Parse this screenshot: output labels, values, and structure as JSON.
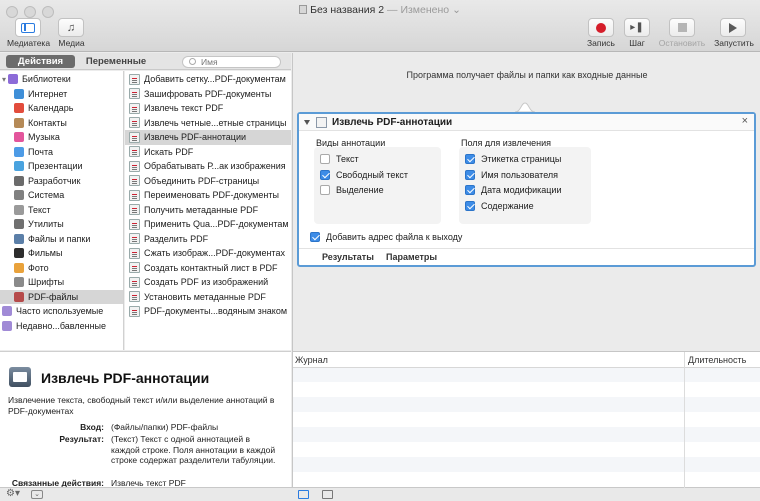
{
  "window": {
    "title": "Без названия 2",
    "status": "— Изменено"
  },
  "toolbar": {
    "library_label": "Медиатека",
    "media_label": "Медиа",
    "record_label": "Запись",
    "step_label": "Шаг",
    "stop_label": "Остановить",
    "run_label": "Запустить"
  },
  "tabs": {
    "actions": "Действия",
    "variables": "Переменные"
  },
  "search": {
    "placeholder": "Имя"
  },
  "library": {
    "items": [
      {
        "label": "Библиотеки",
        "icon": "library-icon",
        "color": "#8c6bd8"
      },
      {
        "label": "Интернет",
        "icon": "globe-icon",
        "color": "#3f8fd8"
      },
      {
        "label": "Календарь",
        "icon": "calendar-icon",
        "color": "#e24c3c"
      },
      {
        "label": "Контакты",
        "icon": "contacts-icon",
        "color": "#b58a57"
      },
      {
        "label": "Музыка",
        "icon": "music-icon",
        "color": "#e3559c"
      },
      {
        "label": "Почта",
        "icon": "mail-icon",
        "color": "#4d9be6"
      },
      {
        "label": "Презентации",
        "icon": "presentation-icon",
        "color": "#4aa3df"
      },
      {
        "label": "Разработчик",
        "icon": "developer-icon",
        "color": "#6b6b6b"
      },
      {
        "label": "Система",
        "icon": "system-icon",
        "color": "#808080"
      },
      {
        "label": "Текст",
        "icon": "text-icon",
        "color": "#9a9a9a"
      },
      {
        "label": "Утилиты",
        "icon": "utilities-icon",
        "color": "#707070"
      },
      {
        "label": "Файлы и папки",
        "icon": "folder-icon",
        "color": "#5b7fa8"
      },
      {
        "label": "Фильмы",
        "icon": "movies-icon",
        "color": "#2d2d2d"
      },
      {
        "label": "Фото",
        "icon": "photo-icon",
        "color": "#e9a23b"
      },
      {
        "label": "Шрифты",
        "icon": "fonts-icon",
        "color": "#8a8a8a"
      },
      {
        "label": "PDF-файлы",
        "icon": "pdf-icon",
        "color": "#b64b4b"
      },
      {
        "label": "Часто используемые",
        "icon": "smart-folder-icon",
        "color": "#a08ad6"
      },
      {
        "label": "Недавно...бавленные",
        "icon": "smart-folder-icon",
        "color": "#a08ad6"
      }
    ]
  },
  "actions": {
    "items": [
      "Добавить сетку...PDF-документам",
      "Зашифровать PDF-документы",
      "Извлечь текст PDF",
      "Извлечь четные...етные страницы",
      "Извлечь PDF-аннотации",
      "Искать PDF",
      "Обрабатывать Р...ак изображения",
      "Объединить PDF-страницы",
      "Переименовать PDF-документы",
      "Получить метаданные PDF",
      "Применить Qua...PDF-документам",
      "Разделить PDF",
      "Сжать изображ...PDF-документах",
      "Создать контактный лист в PDF",
      "Создать PDF из изображений",
      "Установить метаданные PDF",
      "PDF-документы...водяным знаком"
    ]
  },
  "description": {
    "title": "Извлечь PDF-аннотации",
    "text": "Извлечение текста, свободный текст и/или выделение аннотаций в PDF-документах",
    "input_label": "Вход:",
    "input_value": "(Файлы/папки) PDF-файлы",
    "result_label": "Результат:",
    "result_value": "(Текст) Текст с одной аннотацией в каждой строке. Поля аннотации в каждой строке содержат разделители табуляции.",
    "related_label": "Связанные действия:",
    "related_value": "Извлечь текст PDF"
  },
  "workflow": {
    "input_text": "Программа получает файлы и папки как входные данные",
    "card": {
      "title": "Извлечь PDF-аннотации",
      "types_title": "Виды аннотации",
      "types": [
        {
          "label": "Текст",
          "checked": false
        },
        {
          "label": "Свободный текст",
          "checked": true
        },
        {
          "label": "Выделение",
          "checked": false
        }
      ],
      "fields_title": "Поля для извлечения",
      "fields": [
        {
          "label": "Этикетка страницы",
          "checked": true
        },
        {
          "label": "Имя пользователя",
          "checked": true
        },
        {
          "label": "Дата модификации",
          "checked": true
        },
        {
          "label": "Содержание",
          "checked": true
        }
      ],
      "add_path_label": "Добавить адрес файла к выходу",
      "add_path_checked": true,
      "results_label": "Результаты",
      "options_label": "Параметры"
    }
  },
  "log": {
    "col_journal": "Журнал",
    "col_duration": "Длительность"
  }
}
